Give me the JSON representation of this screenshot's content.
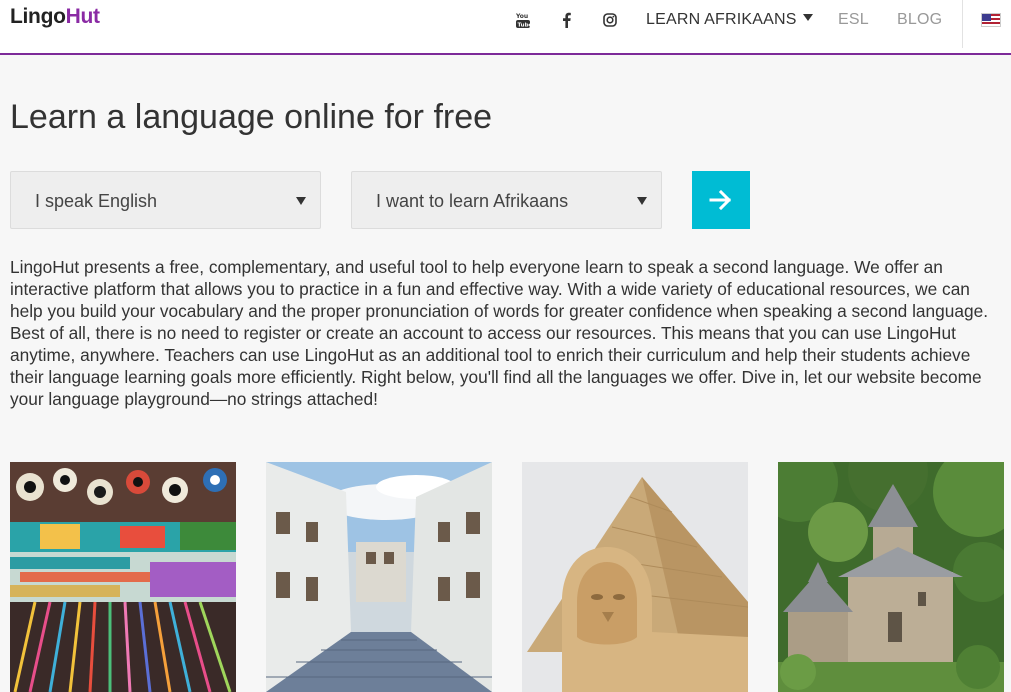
{
  "header": {
    "logo_part1": "Lingo",
    "logo_part2": "Hut",
    "social_icons": [
      "youtube-icon",
      "facebook-icon",
      "instagram-icon"
    ],
    "nav_learn": "LEARN AFRIKAANS",
    "nav_esl": "ESL",
    "nav_blog": "BLOG",
    "flag": "us-flag-icon"
  },
  "hero": {
    "title": "Learn a language online for free",
    "select_speak": "I speak English",
    "select_learn": "I want to learn Afrikaans",
    "go_icon": "arrow-right-icon"
  },
  "intro": "LingoHut presents a free, complementary, and useful tool to help everyone learn to speak a second language. We offer an interactive platform that allows you to practice in a fun and effective way. With a wide variety of educational resources, we can help you build your vocabulary and the proper pronunciation of words for greater confidence when speaking a second language. Best of all, there is no need to register or create an account to access our resources. This means that you can use LingoHut anytime, anywhere. Teachers can use LingoHut as an additional tool to enrich their curriculum and help their students achieve their language learning goals more efficiently. Right below, you'll find all the languages we offer. Dive in, let our website become your language playground—no strings attached!",
  "colors": {
    "accent": "#00bcd4",
    "brand_purple": "#8a2aa4",
    "header_border": "#7d2a99"
  },
  "images": [
    "market-beads-photo",
    "cobblestone-street-photo",
    "sphinx-pyramid-photo",
    "stone-monastery-photo"
  ]
}
